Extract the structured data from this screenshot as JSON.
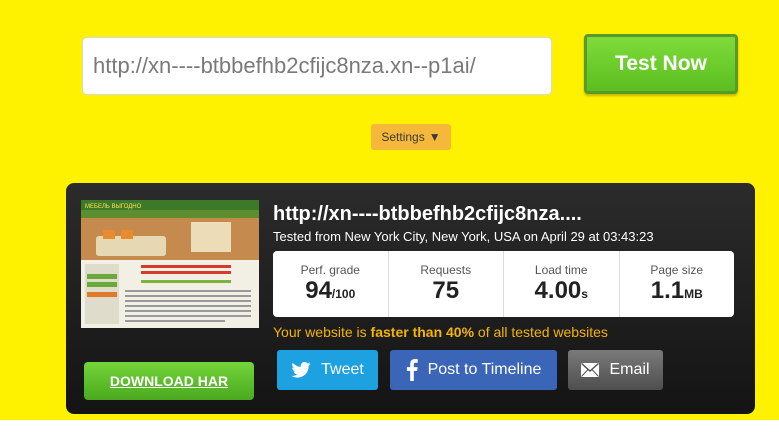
{
  "search": {
    "url_value": "http://xn----btbbefhb2cfijc8nza.xn--p1ai/"
  },
  "actions": {
    "test_label": "Test Now",
    "settings_label": "Settings"
  },
  "result": {
    "site_title": "http://xn----btbbefhb2cfijc8nza....",
    "tested_from": "Tested from New York City, New York, USA on April 29 at 03:43:23",
    "metrics": [
      {
        "label": "Perf. grade",
        "value": "94",
        "unit": "/100"
      },
      {
        "label": "Requests",
        "value": "75",
        "unit": ""
      },
      {
        "label": "Load time",
        "value": "4.00",
        "unit": "s"
      },
      {
        "label": "Page size",
        "value": "1.1",
        "unit": "MB"
      }
    ],
    "summary_pre": "Your website is ",
    "summary_bold": "faster than 40%",
    "summary_post": " of all tested websites",
    "download_label": "DOWNLOAD HAR",
    "share": {
      "tweet": "Tweet",
      "facebook": "Post to Timeline",
      "email": "Email"
    }
  },
  "thumbnail": {
    "site_logo_text": "МЕБЕЛЬ ВЫГОДНО"
  },
  "colors": {
    "background": "#fff200",
    "test_button": "#5bbf1f",
    "settings_button": "#f5b83a",
    "summary_text": "#f5b400",
    "twitter": "#1ea1e0",
    "facebook": "#3b65b7"
  },
  "icons": [
    "chevron-down-icon",
    "twitter-bird-icon",
    "facebook-f-icon",
    "envelope-icon"
  ]
}
